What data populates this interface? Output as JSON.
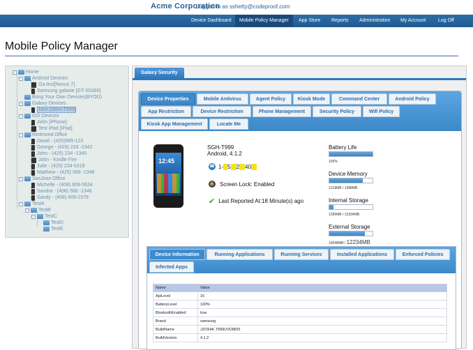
{
  "header": {
    "brand": "Acme Corporation",
    "login_text": "Logged in as sshetty@codeproof.com"
  },
  "nav": {
    "items": [
      {
        "label": "Device Dashboard"
      },
      {
        "label": "Mobile Policy Manager"
      },
      {
        "label": "App Store"
      },
      {
        "label": "Reports"
      },
      {
        "label": "Administration"
      },
      {
        "label": "My Account"
      },
      {
        "label": "Log Off"
      }
    ]
  },
  "page": {
    "title": "Mobile Policy Manager"
  },
  "tree": {
    "nodes": [
      {
        "label": "Home"
      },
      {
        "label": "Android Devices"
      },
      {
        "label": "Ga test[Nexus 7]"
      },
      {
        "label": "Samsung galaxie [GT-S5360]"
      },
      {
        "label": "Bring Your Own Devices(BYOD)"
      },
      {
        "label": "Galaxy Devices"
      },
      {
        "label": "John [SGH-T999]"
      },
      {
        "label": "iOS Devices"
      },
      {
        "label": "John [iPhone]"
      },
      {
        "label": "Test iPad [iPad]"
      },
      {
        "label": "Redmond Office"
      },
      {
        "label": "David - (425)985-123"
      },
      {
        "label": "George - (425) 233 -2342"
      },
      {
        "label": "John - (425) 234 -1345"
      },
      {
        "label": "John - Kindle Fire"
      },
      {
        "label": "Julie - (425) 234-5318"
      },
      {
        "label": "Matthew - (425) 568 -1348"
      },
      {
        "label": "SanJose Office"
      },
      {
        "label": "Michelle - (408) 609-5634"
      },
      {
        "label": "Sandra - (408) 568 -1348"
      },
      {
        "label": "Sandy - (408) 609-2378"
      },
      {
        "label": "TestA"
      },
      {
        "label": "TestB"
      },
      {
        "label": "TestC"
      },
      {
        "label": "TestD"
      },
      {
        "label": "TestE"
      }
    ]
  },
  "panel": {
    "tab_label": "Galaxy Security"
  },
  "policy_tabs": [
    {
      "label": "Device Properties"
    },
    {
      "label": "Mobile Antivirus"
    },
    {
      "label": "Agent Policy"
    },
    {
      "label": "Kiosk Mode"
    },
    {
      "label": "Command Center"
    },
    {
      "label": "Android Policy"
    },
    {
      "label": "App Restriction"
    },
    {
      "label": "Device Restriction"
    },
    {
      "label": "Phone Management"
    },
    {
      "label": "Security Policy"
    },
    {
      "label": "Wifi Policy"
    },
    {
      "label": "Kiosk App Management"
    },
    {
      "label": "Locate Me"
    }
  ],
  "device": {
    "screen_time": "12:45",
    "model": "SGH-T999",
    "os": "Android, 4.1.2",
    "phone_prefix": "1-",
    "phone_masked": "5",
    "phone_mid": "2",
    "phone_end": "40",
    "screen_lock": "Screen Lock: Enabled",
    "last_reported": "Last Reported At:18 Minute(s) ago"
  },
  "stats": {
    "battery_label": "Battery Life",
    "battery_value": "100%",
    "battery_fraction": 1.0,
    "memory_label": "Device Memory",
    "memory_value": "1218MB / 1588MB",
    "memory_fraction": 0.77,
    "internal_label": "Internal Storage",
    "internal_value": "1286MB / 12334MB",
    "internal_fraction": 0.1,
    "external_label": "External Storage",
    "external_value_small": "10048MB /",
    "external_value_big": "12234MB",
    "external_fraction": 0.82
  },
  "info_tabs": [
    {
      "label": "Device Information"
    },
    {
      "label": "Running Applications"
    },
    {
      "label": "Running Services"
    },
    {
      "label": "Installed Applications"
    },
    {
      "label": "Enforced Policies"
    },
    {
      "label": "Infected Apps"
    }
  ],
  "info_table": {
    "headers": [
      "Name",
      "Value"
    ],
    "rows": [
      [
        "ApiLevel",
        "16"
      ],
      [
        "BatteryLevel",
        "100%"
      ],
      [
        "BluetoothEnabled",
        "true"
      ],
      [
        "Brand",
        "samsung"
      ],
      [
        "BuildName",
        "JZO54K.T999UVDMD5"
      ],
      [
        "BuildVersion",
        "4.1.2"
      ]
    ]
  }
}
